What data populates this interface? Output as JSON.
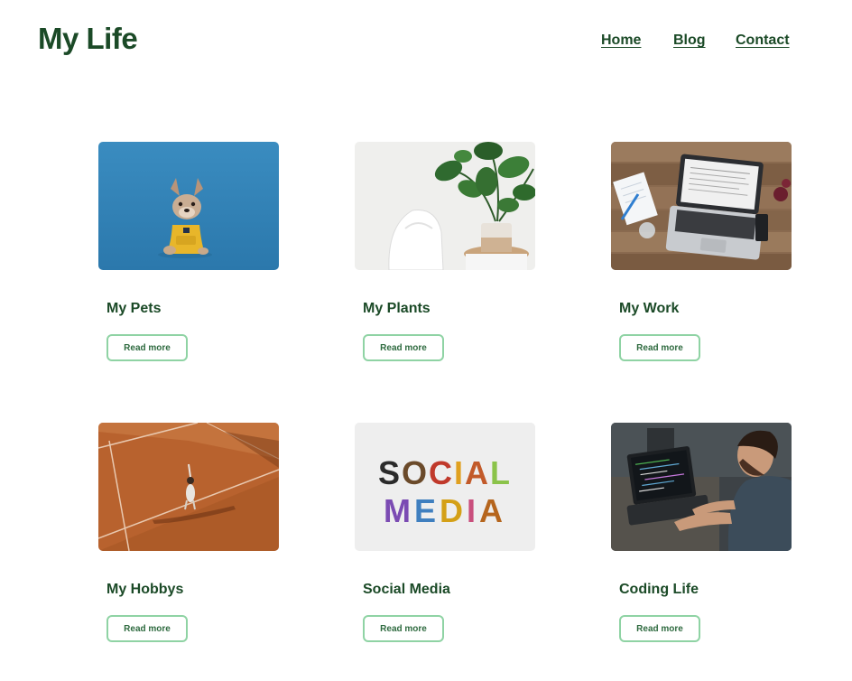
{
  "header": {
    "title": "My Life"
  },
  "nav": {
    "items": [
      {
        "label": "Home"
      },
      {
        "label": "Blog"
      },
      {
        "label": "Contact"
      }
    ]
  },
  "cards": [
    {
      "title": "My Pets",
      "button": "Read more",
      "image": "french-bulldog-yellow-shirt-blue-background"
    },
    {
      "title": "My Plants",
      "button": "Read more",
      "image": "potted-plant-white-chair"
    },
    {
      "title": "My Work",
      "button": "Read more",
      "image": "laptop-on-wooden-desk"
    },
    {
      "title": "My Hobbys",
      "button": "Read more",
      "image": "tennis-player-clay-court-aerial"
    },
    {
      "title": "Social Media",
      "button": "Read more",
      "image": "social-media-colorful-letters"
    },
    {
      "title": "Coding Life",
      "button": "Read more",
      "image": "man-coding-on-laptop"
    }
  ],
  "photo_text": {
    "social_line1": "SOCIAL",
    "social_line2": "MEDIA"
  },
  "colors": {
    "brand_green": "#1b4a27",
    "button_border": "#8fd3a4",
    "button_text": "#2e6a3f",
    "background": "#ffffff"
  }
}
